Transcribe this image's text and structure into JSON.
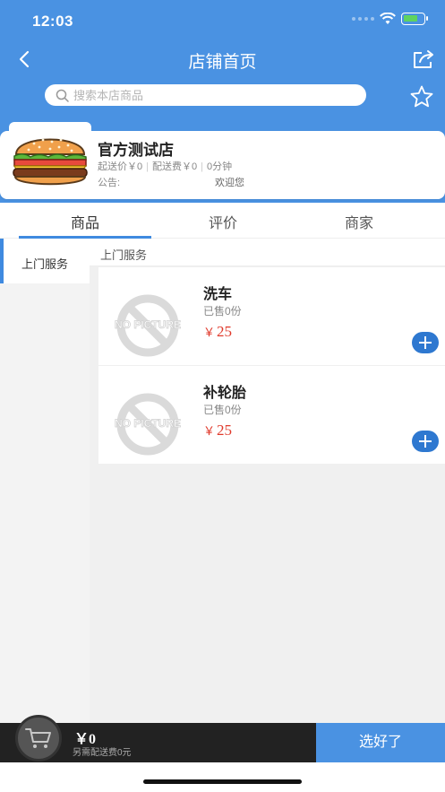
{
  "status_bar": {
    "time": "12:03"
  },
  "nav": {
    "title": "店铺首页"
  },
  "search": {
    "placeholder": "搜索本店商品"
  },
  "store": {
    "name": "官方测试店",
    "min_order": "起送价￥0",
    "delivery_fee": "配送费￥0",
    "delivery_time": "0分钟",
    "notice_label": "公告:",
    "notice_text": "欢迎您"
  },
  "tabs": [
    {
      "label": "商品"
    },
    {
      "label": "评价"
    },
    {
      "label": "商家"
    }
  ],
  "sidebar": {
    "items": [
      {
        "label": "上门服务"
      }
    ]
  },
  "section": {
    "title": "上门服务"
  },
  "products": [
    {
      "name": "洗车",
      "sold": "已售0份",
      "currency": "￥",
      "price": "25",
      "placeholder_text": "NO PICTURE"
    },
    {
      "name": "补轮胎",
      "sold": "已售0份",
      "currency": "￥",
      "price": "25",
      "placeholder_text": "NO PICTURE"
    }
  ],
  "cart": {
    "total": "￥0",
    "note": "另需配送费0元",
    "checkout_label": "选好了"
  },
  "colors": {
    "primary": "#4a92e2",
    "price": "#e0392b",
    "dark": "#222222"
  }
}
